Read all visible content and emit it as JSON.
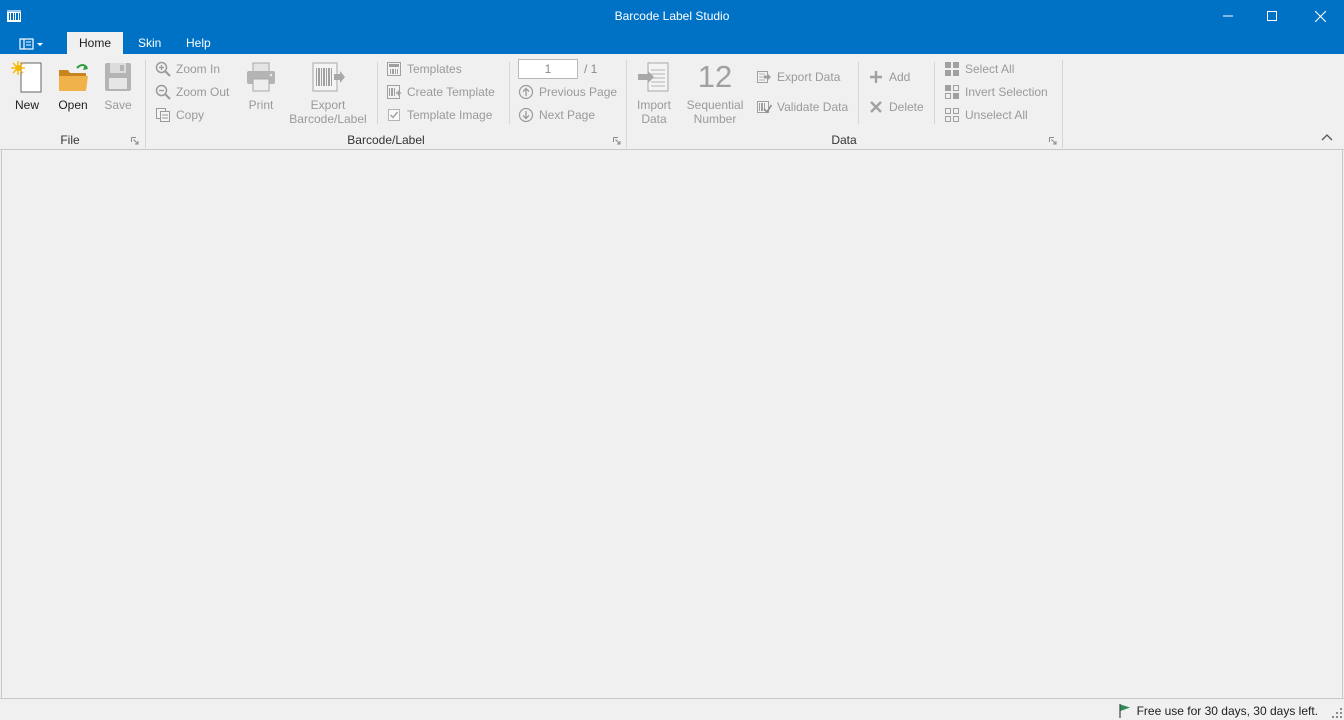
{
  "window": {
    "title": "Barcode Label Studio"
  },
  "tabs": [
    {
      "label": "Home",
      "active": true
    },
    {
      "label": "Skin",
      "active": false
    },
    {
      "label": "Help",
      "active": false
    }
  ],
  "ribbon": {
    "file": {
      "label": "File",
      "new_label": "New",
      "open_label": "Open",
      "save_label": "Save"
    },
    "barcode": {
      "label": "Barcode/Label",
      "zoom_in_label": "Zoom In",
      "zoom_out_label": "Zoom Out",
      "copy_label": "Copy",
      "print_label": "Print",
      "export_label_1": "Export",
      "export_label_2": "Barcode/Label",
      "templates_label": "Templates",
      "create_template_label": "Create Template",
      "template_image_label": "Template Image",
      "page_value": "1",
      "page_total": "/ 1",
      "previous_page_label": "Previous Page",
      "next_page_label": "Next Page"
    },
    "data": {
      "label": "Data",
      "import_label_1": "Import",
      "import_label_2": "Data",
      "sequential_number_glyph": "12",
      "sequential_label_1": "Sequential",
      "sequential_label_2": "Number",
      "export_data_label": "Export Data",
      "validate_data_label": "Validate Data",
      "add_label": "Add",
      "delete_label": "Delete",
      "select_all_label": "Select All",
      "invert_selection_label": "Invert Selection",
      "unselect_all_label": "Unselect All"
    }
  },
  "status": {
    "message": "Free use for 30 days, 30 days left."
  },
  "colors": {
    "titlebar": "#0072c6",
    "background": "#f0f0f0",
    "disabled_text": "#9a9a9a"
  }
}
